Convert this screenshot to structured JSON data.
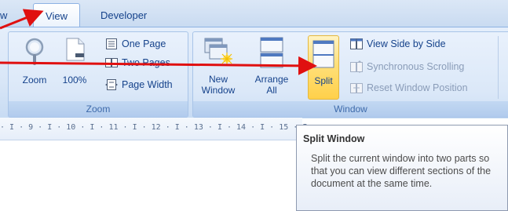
{
  "tabs": {
    "partial_left": "w",
    "view": "View",
    "developer": "Developer"
  },
  "zoom_group": {
    "label": "Zoom",
    "zoom_button": "Zoom",
    "hundred_button": "100%",
    "one_page": "One Page",
    "two_pages": "Two Pages",
    "page_width": "Page Width"
  },
  "window_group": {
    "label": "Window",
    "new_window": [
      "New",
      "Window"
    ],
    "arrange_all": [
      "Arrange",
      "All"
    ],
    "split": "Split",
    "view_side_by_side": "View Side by Side",
    "synchronous_scrolling": "Synchronous Scrolling",
    "reset_window_position": "Reset Window Position"
  },
  "ruler": {
    "text": "· I · 9 · I · 10 · I · 11 · I · 12 · I · 13 · I · 14 · I · 15 · I"
  },
  "tooltip": {
    "title": "Split Window",
    "body": "Split the current window into two parts so that you can view different sections of the document at the same time."
  },
  "colors": {
    "arrow": "#e01010",
    "split_highlight": "#ffd04a"
  },
  "icons": {
    "zoom": "magnifier-icon",
    "hundred": "page-100-icon",
    "one_page": "one-page-icon",
    "two_pages": "two-pages-icon",
    "page_width": "page-width-icon",
    "new_window": "new-window-icon",
    "arrange_all": "arrange-all-icon",
    "split": "split-window-icon",
    "side_by_side": "side-by-side-icon",
    "sync_scroll": "sync-scroll-icon",
    "reset_position": "reset-position-icon"
  }
}
